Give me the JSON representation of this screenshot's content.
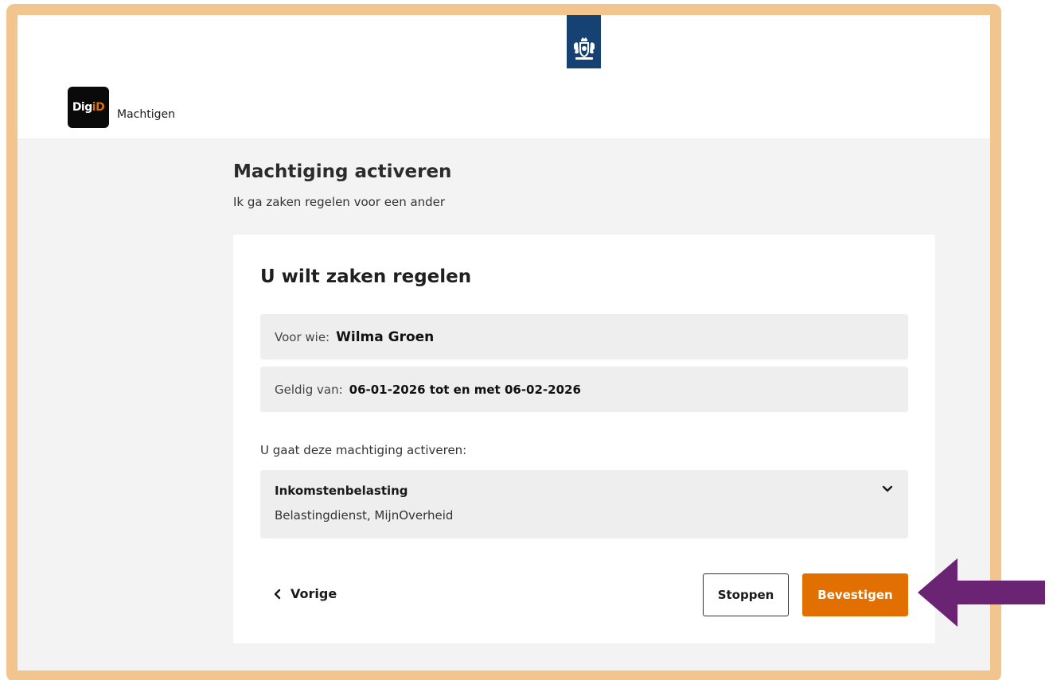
{
  "header": {
    "logo_text_main": "Dig",
    "logo_text_accent": "iD",
    "app_name": "Machtigen"
  },
  "page": {
    "title": "Machtiging activeren",
    "subtitle": "Ik ga zaken regelen voor een ander"
  },
  "card": {
    "title": "U wilt zaken regelen",
    "who_label": "Voor wie:",
    "who_value": "Wilma Groen",
    "valid_label": "Geldig van:",
    "valid_value": "06-01-2026 tot en met 06-02-2026",
    "activate_label": "U gaat deze machtiging activeren:",
    "service": {
      "name": "Inkomstenbelasting",
      "provider": "Belastingdienst, MijnOverheid"
    },
    "back_label": "Vorige",
    "stop_label": "Stoppen",
    "confirm_label": "Bevestigen"
  },
  "colors": {
    "frame": "#f2c58e",
    "brand_orange": "#e17000",
    "rijksoverheid_blue": "#154273",
    "annotation_arrow": "#6b2474"
  },
  "icons": {
    "rijksoverheid": "coat-of-arms-icon",
    "expand": "chevron-down-icon",
    "back": "chevron-left-icon",
    "annotation": "arrow-left-icon"
  }
}
